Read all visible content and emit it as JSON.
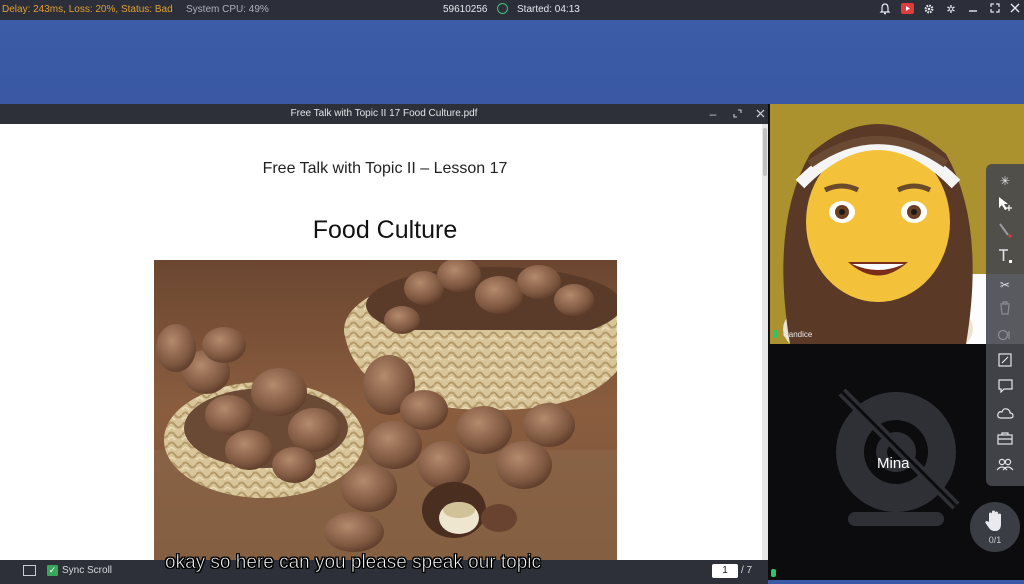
{
  "topbar": {
    "network_status": "Delay: 243ms, Loss: 20%, Status:  Bad",
    "cpu": "System CPU: 49%",
    "class_id": "59610256",
    "started": "Started: 04:13",
    "icons": [
      "bell-icon",
      "record-icon",
      "settings-icon",
      "pin-icon",
      "minimize-icon",
      "fullscreen-icon",
      "close-icon"
    ]
  },
  "pdf": {
    "window_title": "Free Talk with Topic II 17 Food Culture.pdf",
    "lesson_heading": "Free Talk with Topic II – Lesson 17",
    "doc_title": "Food Culture",
    "sync_scroll_label": "Sync Scroll",
    "sync_scroll_checked": true,
    "current_page": "1",
    "total_pages": "/ 7"
  },
  "subtitle": "okay so here can you please speak our topic",
  "video": {
    "teacher_name_tag": "Candice",
    "student_name": "Mina"
  },
  "toolbar": {
    "tools": [
      "laser-pointer-icon",
      "select-icon",
      "pen-icon",
      "text-icon",
      "scissors-icon",
      "trash-icon",
      "shapes-icon",
      "edit-box-icon",
      "chat-icon",
      "cloud-icon",
      "toolbox-icon",
      "users-icon"
    ]
  },
  "hand": {
    "count": "0/1"
  },
  "colors": {
    "accent_green": "#2ec46a",
    "warning_orange": "#e0a030",
    "record_red": "#e23b3b"
  }
}
